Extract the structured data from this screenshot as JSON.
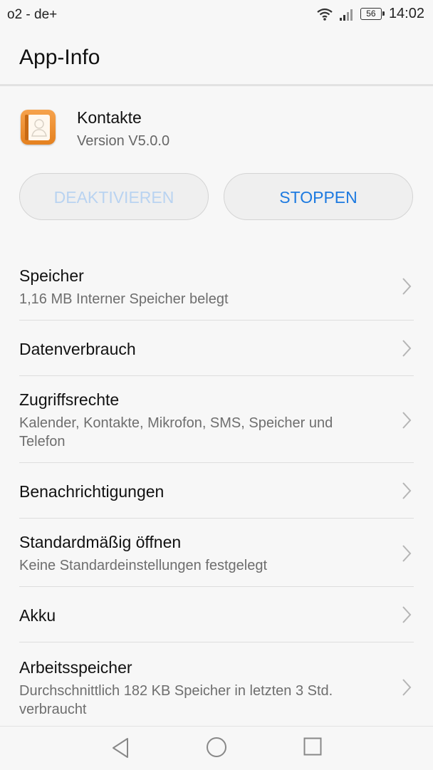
{
  "status_bar": {
    "carrier": "o2 - de+",
    "battery_level": "56",
    "time": "14:02",
    "icons": [
      "wifi-icon",
      "signal-icon",
      "battery-icon"
    ]
  },
  "title_bar": {
    "title": "App-Info"
  },
  "app": {
    "name": "Kontakte",
    "version": "Version V5.0.0",
    "icon": "contacts-app-icon"
  },
  "buttons": {
    "deactivate": "DEAKTIVIEREN",
    "stop": "STOPPEN"
  },
  "settings": [
    {
      "title": "Speicher",
      "subtitle": "1,16 MB Interner Speicher belegt"
    },
    {
      "title": "Datenverbrauch",
      "subtitle": ""
    },
    {
      "title": "Zugriffsrechte",
      "subtitle": "Kalender, Kontakte, Mikrofon, SMS, Speicher und Telefon"
    },
    {
      "title": "Benachrichtigungen",
      "subtitle": ""
    },
    {
      "title": "Standardmäßig öffnen",
      "subtitle": "Keine Standardeinstellungen festgelegt"
    },
    {
      "title": "Akku",
      "subtitle": ""
    },
    {
      "title": "Arbeitsspeicher",
      "subtitle": "Durchschnittlich 182 KB Speicher in letzten 3 Std. verbraucht"
    }
  ],
  "nav_bar": {
    "icons": [
      "back-icon",
      "home-icon",
      "recents-icon"
    ]
  },
  "colors": {
    "accent": "#1d7ae0",
    "disabled_text": "#b9d3f1",
    "background": "#f7f7f7",
    "app_icon": "#ee8f2f"
  }
}
